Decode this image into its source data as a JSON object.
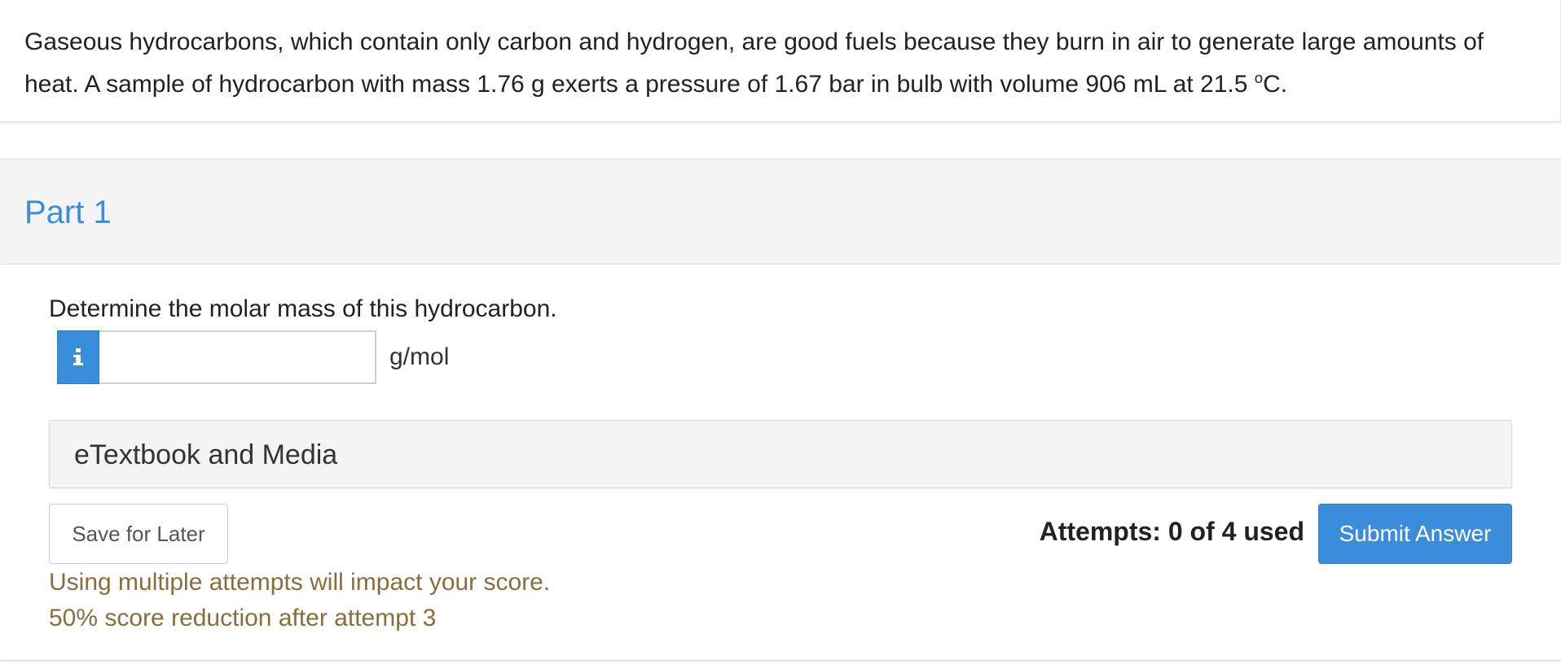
{
  "problem": {
    "text_main": "Gaseous hydrocarbons, which contain only carbon and hydrogen, are good fuels because they burn in air to generate large amounts of heat. A sample of hydrocarbon with mass 1.76 g exerts a pressure of 1.67 bar in bulb with volume 906 mL at 21.5 ",
    "degree_sup": "o",
    "text_end": "C."
  },
  "part": {
    "title": "Part 1",
    "question": "Determine the molar mass of this hydrocarbon.",
    "answer_value": "",
    "unit": "g/mol",
    "info_icon": "info-icon"
  },
  "media": {
    "label": "eTextbook and Media"
  },
  "actions": {
    "save_label": "Save for Later",
    "attempts_text": "Attempts: 0 of 4 used",
    "submit_label": "Submit Answer"
  },
  "warnings": {
    "line1": "Using multiple attempts will impact your score.",
    "line2": "50% score reduction after attempt 3"
  },
  "colors": {
    "accent": "#3a8ddb",
    "warning": "#8a6d3b",
    "panel_bg": "#f4f4f4"
  }
}
